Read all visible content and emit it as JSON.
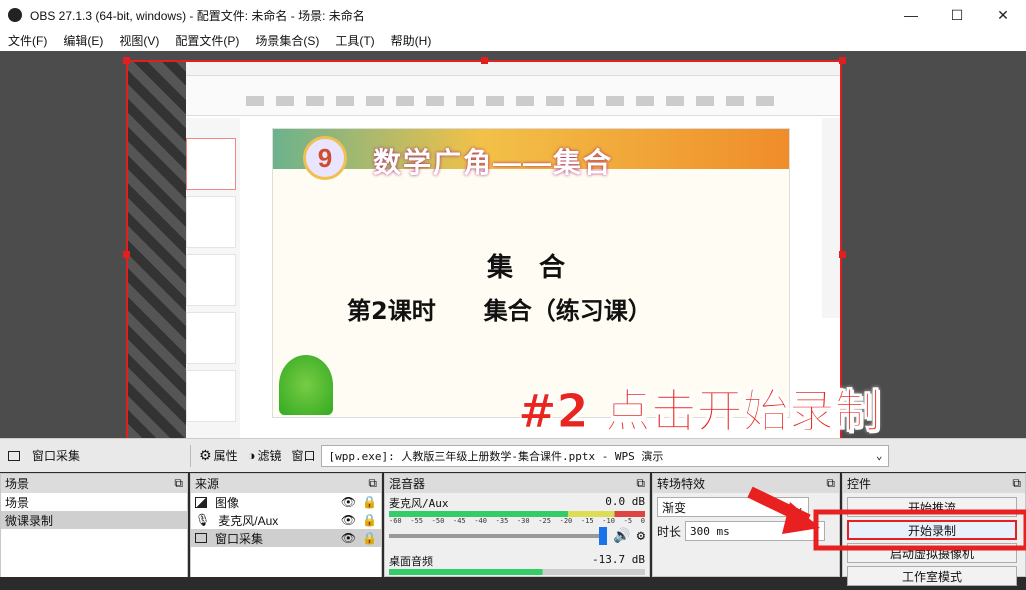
{
  "window": {
    "title": "OBS 27.1.3 (64-bit, windows) - 配置文件: 未命名 - 场景: 未命名",
    "minimize": "—",
    "maximize": "☐",
    "close": "✕"
  },
  "menu": [
    "文件(F)",
    "编辑(E)",
    "视图(V)",
    "配置文件(P)",
    "场景集合(S)",
    "工具(T)",
    "帮助(H)"
  ],
  "slide": {
    "badge": "9",
    "title": "数学广角——集合",
    "line1": "集　合",
    "line2": "第2课时　　集合（练习课）"
  },
  "annotation": "#2 点击开始录制",
  "context_bar": {
    "source_label": "窗口采集",
    "properties": "属性",
    "filters": "滤镜",
    "window_label": "窗口",
    "window_value": "[wpp.exe]: 人教版三年级上册数学-集合课件.pptx - WPS 演示"
  },
  "scenes": {
    "title": "场景",
    "items": [
      "场景",
      "微课录制"
    ]
  },
  "sources": {
    "title": "来源",
    "items": [
      {
        "label": "图像",
        "icon": "image-icon"
      },
      {
        "label": "麦克风/Aux",
        "icon": "mic-icon"
      },
      {
        "label": "窗口采集",
        "icon": "window-icon"
      }
    ]
  },
  "mixer": {
    "title": "混音器",
    "ch1": {
      "name": "麦克风/Aux",
      "db": "0.0 dB"
    },
    "ch2": {
      "name": "桌面音频",
      "db": "-13.7 dB"
    },
    "ticks": [
      "-60",
      "-55",
      "-50",
      "-45",
      "-40",
      "-35",
      "-30",
      "-25",
      "-20",
      "-15",
      "-10",
      "-5",
      "0"
    ]
  },
  "transitions": {
    "title": "转场特效",
    "type": "渐变",
    "duration_label": "时长",
    "duration": "300 ms"
  },
  "controls": {
    "title": "控件",
    "stream": "开始推流",
    "record": "开始录制",
    "vcam": "启动虚拟摄像机",
    "studio": "工作室模式"
  }
}
